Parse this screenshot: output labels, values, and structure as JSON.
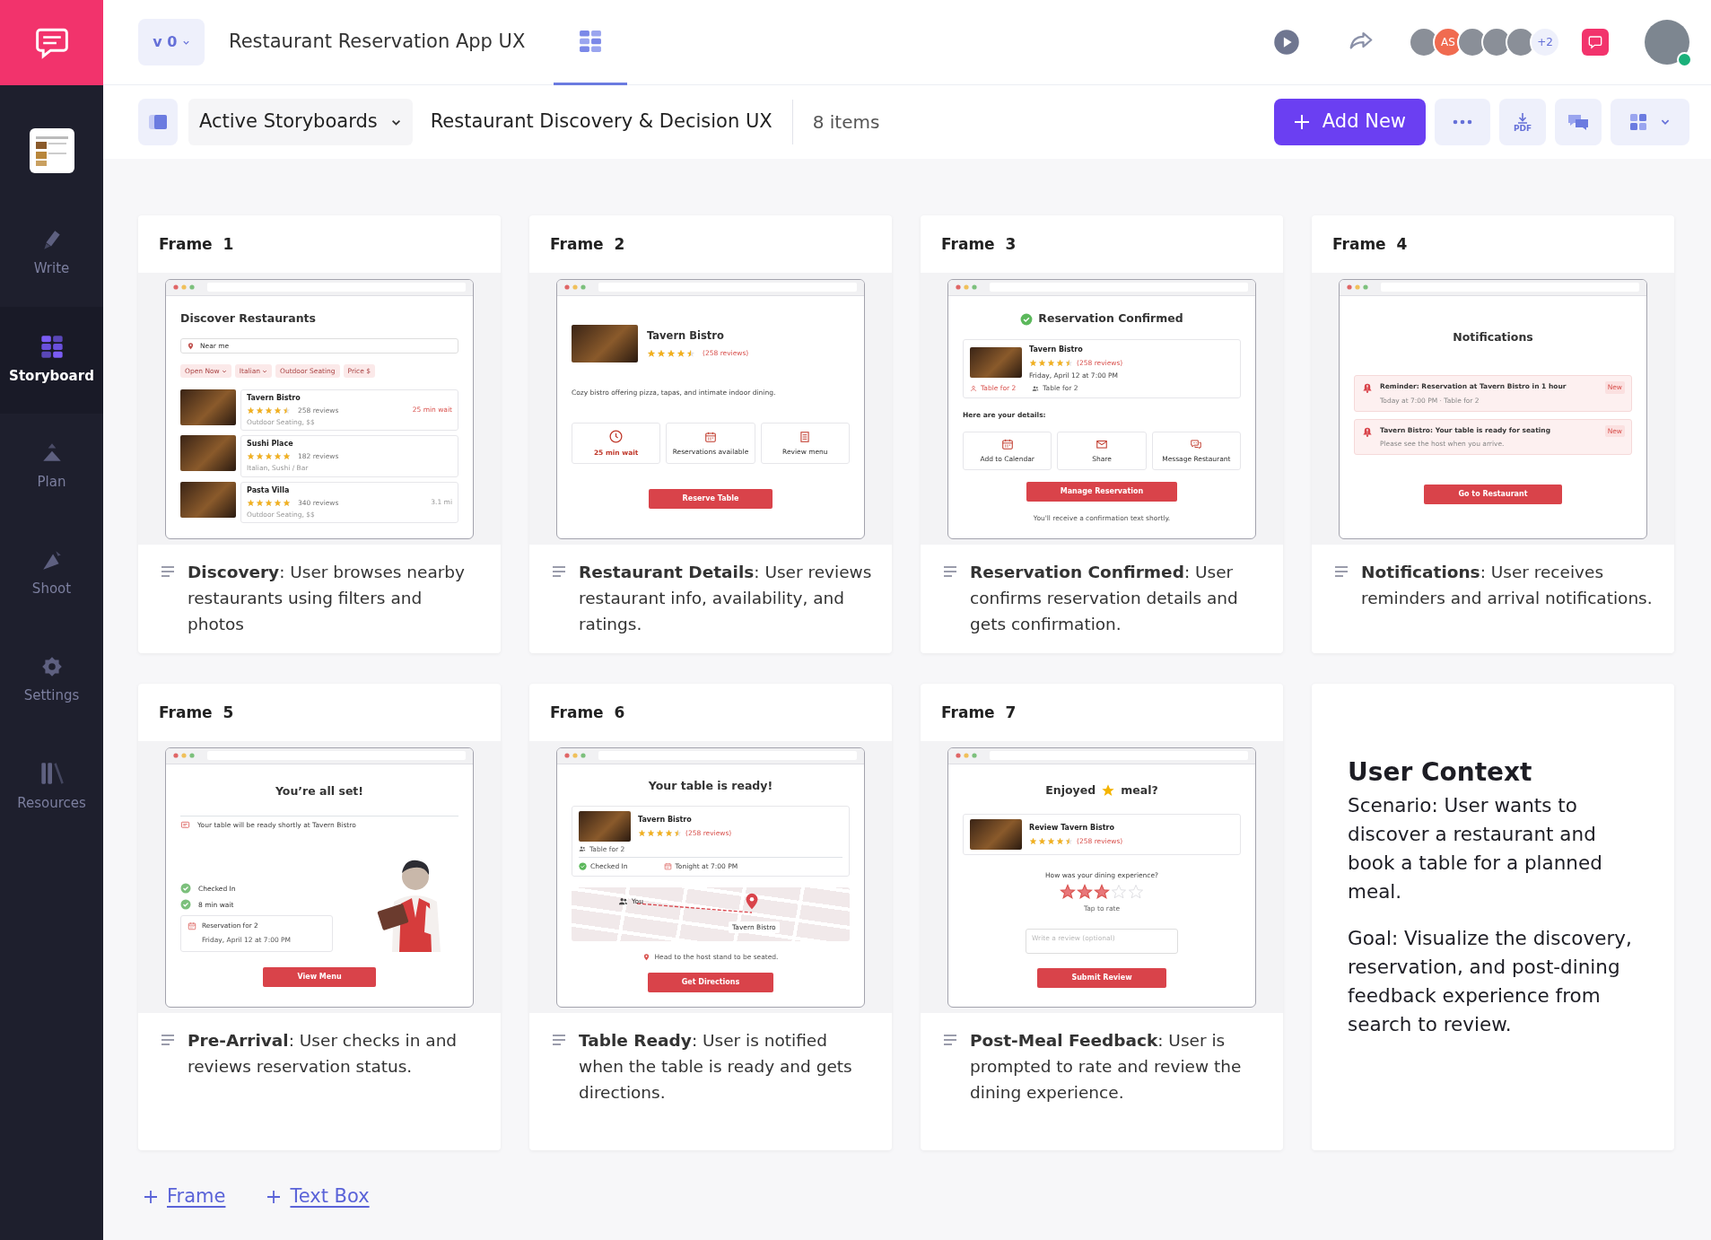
{
  "sidebar": {
    "items": [
      {
        "label": "Write",
        "selected": false
      },
      {
        "label": "Storyboard",
        "selected": true
      },
      {
        "label": "Plan",
        "selected": false
      },
      {
        "label": "Shoot",
        "selected": false
      },
      {
        "label": "Settings",
        "selected": false
      },
      {
        "label": "Resources",
        "selected": false
      }
    ]
  },
  "topbar": {
    "version": "v 0",
    "title": "Restaurant Reservation App UX",
    "avatars": [
      {
        "kind": "photo"
      },
      {
        "kind": "initials",
        "text": "AS"
      },
      {
        "kind": "photo"
      },
      {
        "kind": "photo"
      },
      {
        "kind": "photo"
      }
    ],
    "more_count": "+2"
  },
  "toolbar": {
    "view": "Active Storyboards",
    "board": "Restaurant Discovery & Decision UX",
    "count": "8 items",
    "add_label": "Add New",
    "pdf_label": "PDF"
  },
  "frames": [
    {
      "title": "Frame  1",
      "description": "**Discovery**: User browses nearby restaurants using filters and photos",
      "mockup": {
        "blocks": [
          {
            "kind": "left_heading",
            "text": "Discover Restaurants"
          },
          {
            "kind": "search",
            "value": "Near me"
          },
          {
            "kind": "chips",
            "items": [
              {
                "label": "Open Now",
                "dropdown": true
              },
              {
                "label": "Italian",
                "dropdown": true
              },
              {
                "label": "Outdoor Seating",
                "dropdown": false
              },
              {
                "label": "Price $",
                "dropdown": false
              }
            ]
          },
          {
            "kind": "listing",
            "items": [
              {
                "name": "Tavern Bistro",
                "stars": 4.5,
                "reviews": "258 reviews",
                "meta": "Outdoor Seating, $$",
                "aside": "25 min wait",
                "highlight": true
              },
              {
                "name": "Sushi Place",
                "stars": 5,
                "reviews": "182 reviews",
                "meta": "Italian, Sushi / Bar"
              },
              {
                "name": "Pasta Villa",
                "stars": 5,
                "reviews": "340 reviews",
                "meta": "Outdoor Seating, $$",
                "aside": "3.1 mi",
                "highlight": false
              }
            ]
          }
        ]
      }
    },
    {
      "title": "Frame  2",
      "description": "**Restaurant Details**: User reviews restaurant info, availability, and ratings.",
      "mockup": {
        "blocks": [
          {
            "kind": "hero",
            "name": "Tavern Bistro",
            "stars": 4.5,
            "reviews": "(258 reviews)"
          },
          {
            "kind": "text",
            "text": "Cozy bistro offering pizza, tapas, and intimate indoor dining."
          },
          {
            "kind": "tiles",
            "items": [
              {
                "kind": "clock",
                "label": "25 min wait",
                "accent": true
              },
              {
                "kind": "calendar",
                "label": "Reservations available",
                "accent": false
              },
              {
                "kind": "list",
                "label": "Review menu",
                "accent": false
              }
            ]
          },
          {
            "kind": "button",
            "label": "Reserve Table"
          }
        ]
      }
    },
    {
      "title": "Frame  3",
      "description": "**Reservation Confirmed**: User confirms reservation details and gets confirmation.",
      "mockup": {
        "blocks": [
          {
            "kind": "check_heading",
            "text": "Reservation Confirmed"
          },
          {
            "kind": "summary",
            "name": "Tavern Bistro",
            "stars": 4.5,
            "reviews": "(258 reviews)",
            "lines": [
              "Friday, April 12 at 7:00 PM"
            ],
            "tags": [
              {
                "kind": "person",
                "text": "Table for 2",
                "accent": true
              },
              {
                "kind": "people",
                "text": "Table for 2",
                "accent": false
              }
            ]
          },
          {
            "kind": "label",
            "text": "Here are your details:"
          },
          {
            "kind": "tiles",
            "items": [
              {
                "kind": "calendar",
                "label": "Add to Calendar",
                "accent": false
              },
              {
                "kind": "mail",
                "label": "Share",
                "accent": false
              },
              {
                "kind": "chat",
                "label": "Message Restaurant",
                "accent": false
              }
            ]
          },
          {
            "kind": "button",
            "label": "Manage Reservation"
          },
          {
            "kind": "note",
            "text": "You'll receive a confirmation text shortly.",
            "with_pin": false
          }
        ]
      }
    },
    {
      "title": "Frame  4",
      "description": "**Notifications**: User receives reminders and arrival notifications.",
      "mockup": {
        "blocks": [
          {
            "kind": "heading",
            "text": "Notifications"
          },
          {
            "kind": "notices",
            "items": [
              {
                "title": "Reminder: Reservation at Tavern Bistro in 1 hour",
                "badge": "New",
                "meta": "Today at 7:00 PM · Table for 2"
              },
              {
                "title": "Tavern Bistro: Your table is ready for seating",
                "badge": "New",
                "meta": "Please see the host when you arrive."
              }
            ]
          },
          {
            "kind": "button",
            "label": "Go to Restaurant"
          }
        ]
      }
    },
    {
      "title": "Frame  5",
      "description": "**Pre-Arrival**: User checks in and reviews reservation status.",
      "mockup": {
        "blocks": [
          {
            "kind": "heading",
            "text": "You’re all set!"
          },
          {
            "kind": "info",
            "text": "Your table will be ready shortly at Tavern Bistro"
          },
          {
            "kind": "checkin",
            "checks": [
              "Checked In",
              "8 min wait"
            ],
            "title": "Reservation for 2",
            "detail": "Friday, April 12 at 7:00 PM"
          },
          {
            "kind": "button",
            "label": "View Menu"
          }
        ]
      }
    },
    {
      "title": "Frame  6",
      "description": "**Table Ready**: User is notified when the table is ready and gets directions.",
      "mockup": {
        "blocks": [
          {
            "kind": "heading",
            "text": "Your table is ready!"
          },
          {
            "kind": "summary",
            "name": "Tavern Bistro",
            "stars": 4.5,
            "reviews": "(258 reviews)",
            "tags": [
              {
                "kind": "people",
                "text": "Table for 2",
                "accent": false
              }
            ],
            "footer": [
              {
                "kind": "check",
                "text": "Checked In"
              },
              {
                "kind": "calendar",
                "text": "Tonight at 7:00 PM"
              }
            ]
          },
          {
            "kind": "map",
            "you": "You",
            "place": "Tavern Bistro"
          },
          {
            "kind": "note",
            "text": "Head to the host stand to be seated.",
            "with_pin": true
          },
          {
            "kind": "button",
            "label": "Get Directions"
          }
        ]
      }
    },
    {
      "title": "Frame  7",
      "description": "**Post-Meal Feedback**: User is prompted to rate and review the dining experience.",
      "mockup": {
        "blocks": [
          {
            "kind": "star_heading",
            "text": "Enjoyed",
            "text_after": "meal?"
          },
          {
            "kind": "summary",
            "name": "Review Tavern Bistro",
            "stars": 4.5,
            "reviews": "(258 reviews)"
          },
          {
            "kind": "rating",
            "prompt": "How was your dining experience?",
            "stars": 3,
            "hint": "Tap to rate"
          },
          {
            "kind": "textarea",
            "placeholder": "Write a review (optional)"
          },
          {
            "kind": "button",
            "label": "Submit Review"
          }
        ]
      }
    }
  ],
  "context": {
    "title": "User Context",
    "paragraphs": [
      "Scenario: User wants to discover a restaurant and book a table for a planned meal.",
      "Goal: Visualize the discovery, reservation, and post-dining feedback experience from search to review."
    ]
  },
  "add_links": [
    "Frame",
    "Text Box"
  ]
}
